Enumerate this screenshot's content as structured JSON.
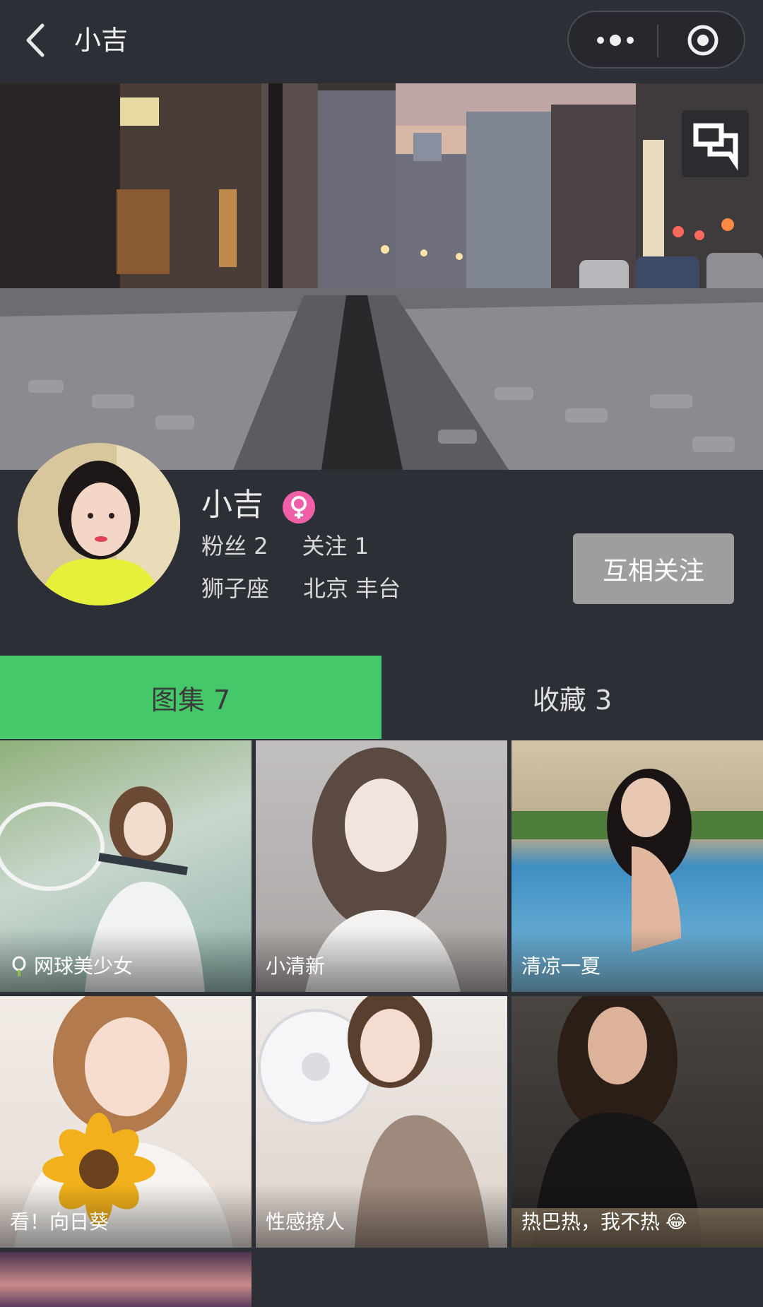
{
  "navbar": {
    "title": "小吉",
    "back_icon": "chevron-left-icon",
    "more_icon": "more-dots-icon",
    "target_icon": "target-circle-icon"
  },
  "cover": {
    "message_icon": "message-icon"
  },
  "profile": {
    "name": "小吉",
    "gender_icon": "female-icon",
    "fans": "粉丝 2",
    "following": "关注 1",
    "zodiac": "狮子座",
    "location": "北京 丰台",
    "follow_button": "互相关注"
  },
  "tabs": [
    {
      "label": "图集 7",
      "active": true
    },
    {
      "label": "收藏 3",
      "active": false
    }
  ],
  "gallery": [
    {
      "caption": "网球美少女",
      "icon": "tennis-icon",
      "colors": [
        "#7fa26f",
        "#c7d3c9",
        "#9db6b1"
      ]
    },
    {
      "caption": "小清新",
      "colors": [
        "#bfbcbc",
        "#6b5a52",
        "#e6e2de"
      ]
    },
    {
      "caption": "清凉一夏",
      "colors": [
        "#c9b99a",
        "#2f7fb4",
        "#8cc5e2"
      ]
    },
    {
      "caption": "看！向日葵",
      "colors": [
        "#efe7e0",
        "#c58b5e",
        "#e8a228"
      ]
    },
    {
      "caption": "性感撩人",
      "colors": [
        "#eee9e6",
        "#8a7a72",
        "#d8c8bc"
      ]
    },
    {
      "caption": "热巴热，我不热",
      "emoji": "😂",
      "colors": [
        "#3b3733",
        "#1d1b1c",
        "#a89a88"
      ]
    },
    {
      "caption": "",
      "colors": [
        "#3a2a3c",
        "#c98b8a",
        "#5b3d5e"
      ]
    }
  ],
  "colors": {
    "background": "#2d2f37",
    "accent_green": "#45c869",
    "follow_button": "#9e9e9e",
    "gender_pink": "#f15fa8"
  }
}
